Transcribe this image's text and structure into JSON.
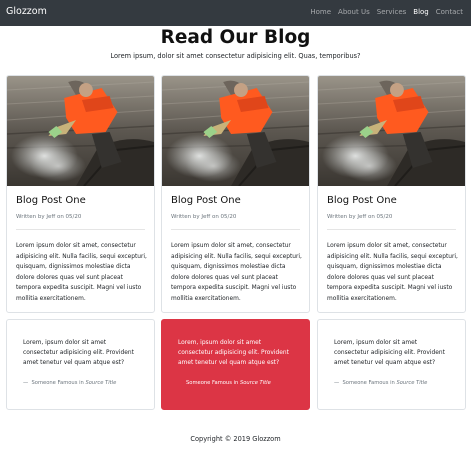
{
  "navbar": {
    "brand": "Glozzom",
    "links": [
      {
        "label": "Home",
        "active": false
      },
      {
        "label": "About Us",
        "active": false
      },
      {
        "label": "Services",
        "active": false
      },
      {
        "label": "Blog",
        "active": true
      },
      {
        "label": "Contact",
        "active": false
      }
    ]
  },
  "header": {
    "title": "Read Our Blog",
    "subtitle": "Lorem ipsum, dolor sit amet consectetur adipisicing elit. Quas, temporibus?"
  },
  "posts": [
    {
      "image": "fisherman-boat-photo",
      "title": "Blog Post One",
      "meta": "Written by Jeff on 05/20",
      "lines": [
        "Lorem ipsum dolor sit amet, consectetur",
        "adipisicing elit. Nulla facilis, sequi excepturi,",
        "quisquam, dignissimos molestiae dicta",
        "dolore dolores quas vel sunt placeat",
        "tempora expedita suscipit. Magni vel iusto",
        "mollitia exercitationem."
      ]
    },
    {
      "image": "fisherman-boat-photo",
      "title": "Blog Post One",
      "meta": "Written by Jeff on 05/20",
      "lines": [
        "Lorem ipsum dolor sit amet, consectetur",
        "adipisicing elit. Nulla facilis, sequi excepturi,",
        "quisquam, dignissimos molestiae dicta",
        "dolore dolores quas vel sunt placeat",
        "tempora expedita suscipit. Magni vel iusto",
        "mollitia exercitationem."
      ]
    },
    {
      "image": "fisherman-boat-photo",
      "title": "Blog Post One",
      "meta": "Written by Jeff on 05/20",
      "lines": [
        "Lorem ipsum dolor sit amet, consectetur",
        "adipisicing elit. Nulla facilis, sequi excepturi,",
        "quisquam, dignissimos molestiae dicta",
        "dolore dolores quas vel sunt placeat",
        "tempora expedita suscipit. Magni vel iusto",
        "mollitia exercitationem."
      ]
    }
  ],
  "quotes": [
    {
      "lines": [
        "Lorem, ipsum dolor sit amet",
        "consectetur adipisicing elit. Provident",
        "amet tenetur vel quam atque est?"
      ],
      "dash": "—",
      "author": "Someone Famous in ",
      "source": "Source Title",
      "highlighted": false
    },
    {
      "lines": [
        "Lorem, ipsum dolor sit amet",
        "consectetur adipisicing elit. Provident",
        "amet tenetur vel quam atque est?"
      ],
      "dash": "",
      "author": "Someone Famous in ",
      "source": "Source Title",
      "highlighted": true
    },
    {
      "lines": [
        "Lorem, ipsum dolor sit amet",
        "consectetur adipisicing elit. Provident",
        "amet tenetur vel quam atque est?"
      ],
      "dash": "—",
      "author": "Someone Famous in ",
      "source": "Source Title",
      "highlighted": false
    }
  ],
  "footer": {
    "copyright": "Copyright © 2019 Glozzom"
  },
  "colors": {
    "navbar": "#343a40",
    "highlight": "#dc3545",
    "border": "#dee2e6"
  }
}
